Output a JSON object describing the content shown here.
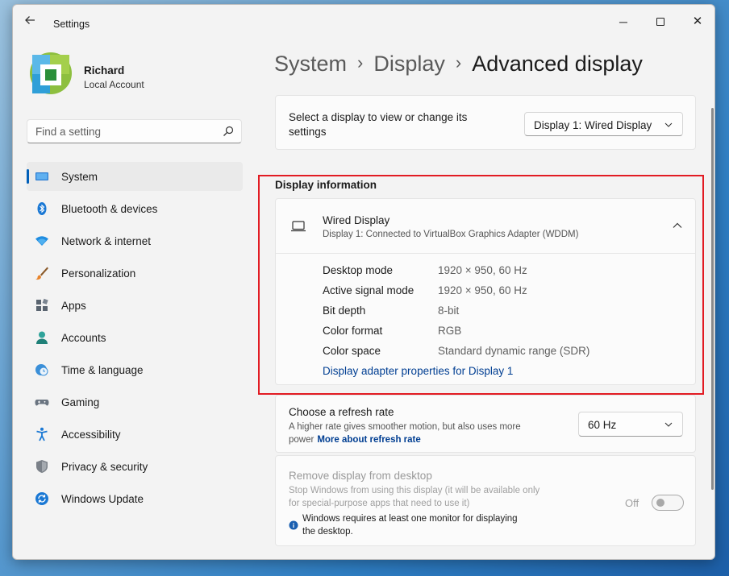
{
  "window": {
    "title": "Settings",
    "controls": {
      "minimize": "─",
      "close": "✕"
    }
  },
  "profile": {
    "name": "Richard",
    "account_type": "Local Account"
  },
  "search": {
    "placeholder": "Find a setting"
  },
  "sidebar": {
    "items": [
      {
        "label": "System",
        "icon": "system-icon",
        "active": true
      },
      {
        "label": "Bluetooth & devices",
        "icon": "bluetooth-icon"
      },
      {
        "label": "Network & internet",
        "icon": "network-icon"
      },
      {
        "label": "Personalization",
        "icon": "brush-icon"
      },
      {
        "label": "Apps",
        "icon": "apps-icon"
      },
      {
        "label": "Accounts",
        "icon": "accounts-icon"
      },
      {
        "label": "Time & language",
        "icon": "time-language-icon"
      },
      {
        "label": "Gaming",
        "icon": "gaming-icon"
      },
      {
        "label": "Accessibility",
        "icon": "accessibility-icon"
      },
      {
        "label": "Privacy & security",
        "icon": "shield-icon"
      },
      {
        "label": "Windows Update",
        "icon": "windows-update-icon"
      }
    ]
  },
  "breadcrumb": {
    "items": [
      "System",
      "Display"
    ],
    "separator": "›",
    "current": "Advanced display"
  },
  "select_display": {
    "label": "Select a display to view or change its settings",
    "value": "Display 1: Wired Display"
  },
  "display_info": {
    "section_title": "Display information",
    "name": "Wired Display",
    "subtitle": "Display 1: Connected to VirtualBox Graphics Adapter (WDDM)",
    "rows": [
      {
        "key": "Desktop mode",
        "value": "1920 × 950, 60 Hz"
      },
      {
        "key": "Active signal mode",
        "value": "1920 × 950, 60 Hz"
      },
      {
        "key": "Bit depth",
        "value": "8-bit"
      },
      {
        "key": "Color format",
        "value": "RGB"
      },
      {
        "key": "Color space",
        "value": "Standard dynamic range (SDR)"
      }
    ],
    "adapter_link": "Display adapter properties for Display 1"
  },
  "refresh_rate": {
    "title": "Choose a refresh rate",
    "description": "A higher rate gives smoother motion, but also uses more power",
    "link": "More about refresh rate",
    "value": "60 Hz"
  },
  "remove_display": {
    "title": "Remove display from desktop",
    "description": "Stop Windows from using this display (it will be available only for special-purpose apps that need to use it)",
    "note": "Windows requires at least one monitor for displaying the desktop.",
    "toggle_state": "Off",
    "toggle_on": false
  },
  "colors": {
    "accent": "#005fb8",
    "link": "#003e92",
    "highlight_frame": "#e21b23"
  }
}
